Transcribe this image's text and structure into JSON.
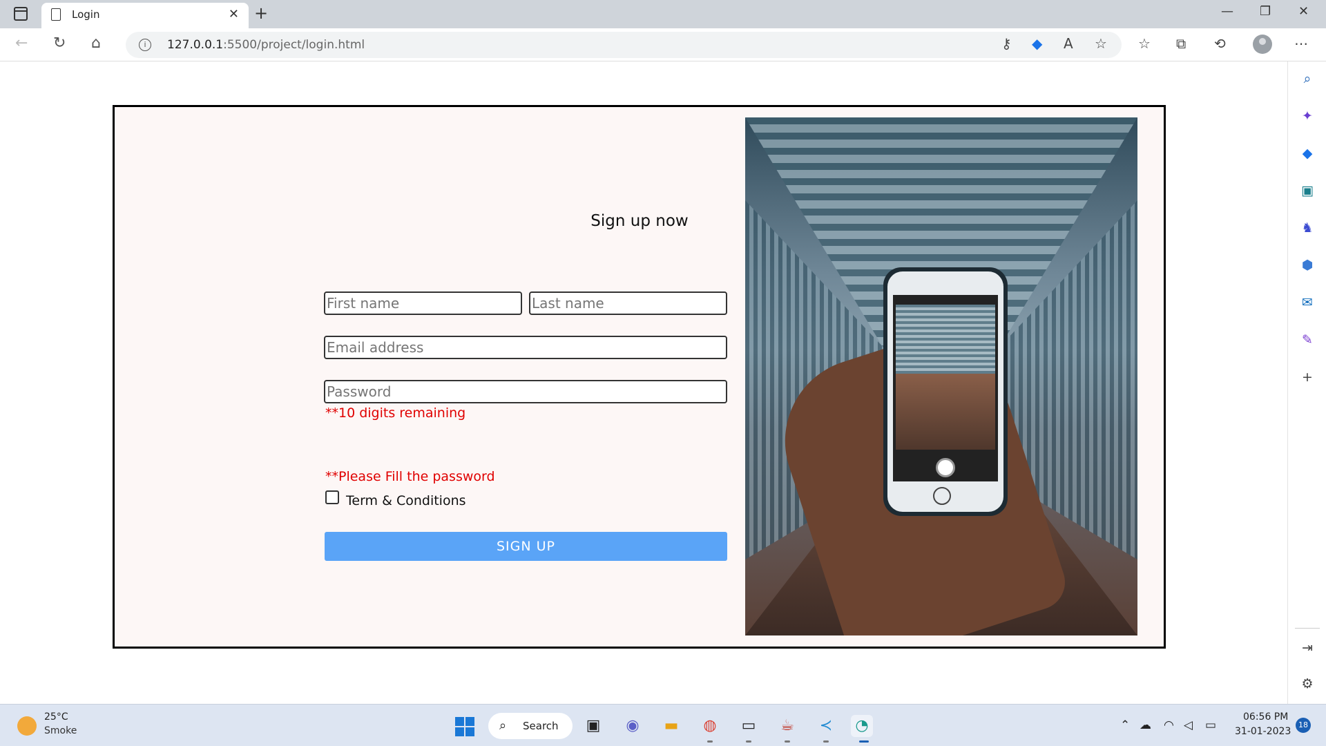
{
  "browser": {
    "tab_title": "Login",
    "new_tab": "+",
    "close_tab": "✕",
    "address": {
      "host": "127.0.0.1",
      "rest": ":5500/project/login.html"
    },
    "window": {
      "minimize": "—",
      "restore": "❐",
      "close": "✕"
    }
  },
  "form": {
    "title": "Sign up now",
    "first_name_placeholder": "First name",
    "last_name_placeholder": "Last name",
    "email_placeholder": "Email address",
    "password_placeholder": "Password",
    "password_hint": "**10 digits remaining",
    "password_error": "**Please Fill the password",
    "terms_label": "Term & Conditions",
    "submit_label": "SIGN UP"
  },
  "colors": {
    "error": "#e00000",
    "button": "#5aa4f7",
    "card_bg": "#fdf7f6"
  },
  "taskbar": {
    "weather_temp": "25°C",
    "weather_desc": "Smoke",
    "search_label": "Search",
    "time": "06:56 PM",
    "date": "31-01-2023",
    "notifications": "18"
  }
}
